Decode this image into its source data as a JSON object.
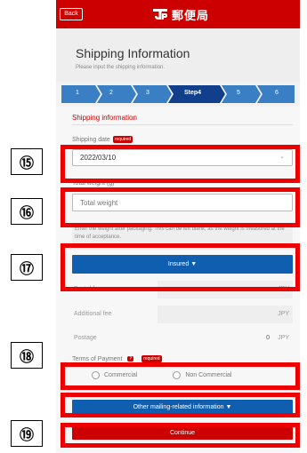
{
  "app": {
    "back_label": "Back",
    "logo_text": "郵便局",
    "title": "Shipping Information",
    "subtitle": "Please input the shipping information."
  },
  "steps": [
    {
      "label": "1",
      "active": false
    },
    {
      "label": "2",
      "active": false
    },
    {
      "label": "3",
      "active": false
    },
    {
      "label": "Step4",
      "active": true
    },
    {
      "label": "5",
      "active": false
    },
    {
      "label": "6",
      "active": false
    }
  ],
  "form": {
    "section_title": "Shipping information",
    "required_badge": "required",
    "shipping_date_label": "Shipping date",
    "shipping_date_value": "2022/03/10",
    "total_weight_label": "Total weight (g)",
    "total_weight_placeholder": "Total weight",
    "weight_note": "Enter the weight after packaging. This can be left blank, as the weight is measured at the time of acceptance.",
    "insured_button": "Insured",
    "postal_fee_label": "Postal fee",
    "additional_fee_label": "Additional fee",
    "postage_label": "Postage",
    "postage_value": "0",
    "currency_unit": "JPY",
    "terms_label": "Terms of Payment",
    "help_icon_glyph": "?",
    "commercial_label": "Commercial",
    "non_commercial_label": "Non Commercial",
    "other_info_button": "Other mailing-related information",
    "continue_button": "Continue"
  },
  "annotations": [
    "⑮",
    "⑯",
    "⑰",
    "⑱",
    "⑲"
  ],
  "colors": {
    "brand_red": "#cc0000",
    "button_blue": "#0f5eb0",
    "annotation_red": "#ee0000",
    "step_blue": "#3a7ec4",
    "step_active": "#123f8c"
  }
}
